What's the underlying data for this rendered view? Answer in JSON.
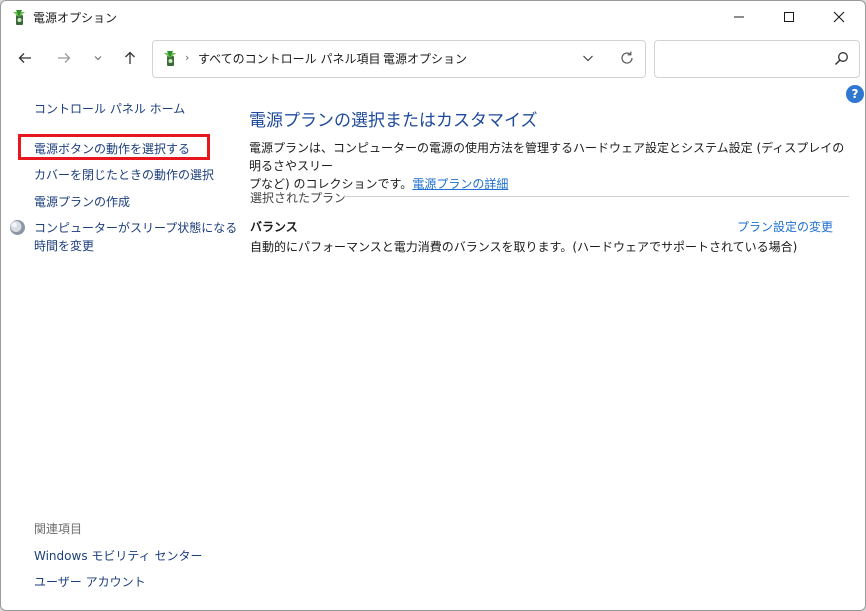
{
  "window": {
    "title": "電源オプション",
    "icon": "power-options-icon"
  },
  "titlebar_buttons": {
    "minimize_icon": "minimize-icon",
    "maximize_icon": "maximize-icon",
    "close_icon": "close-icon"
  },
  "nav": {
    "back_icon": "arrow-left-icon",
    "forward_icon": "arrow-right-icon",
    "recent_icon": "chevron-down-icon",
    "up_icon": "arrow-up-icon"
  },
  "address": {
    "crumb_root": "すべてのコントロール パネル項目",
    "crumb_current": "電源オプション",
    "separator": "›"
  },
  "search": {
    "value": "",
    "icon": "search-icon"
  },
  "sidebar": {
    "home": "コントロール パネル ホーム",
    "items": [
      {
        "label": "電源ボタンの動作を選択する",
        "highlighted": true
      },
      {
        "label": "カバーを閉じたときの動作の選択"
      },
      {
        "label": "電源プランの作成"
      },
      {
        "label": "コンピューターがスリープ状態になる",
        "label2": "時間を変更",
        "icon": "moon-icon"
      }
    ],
    "related_heading": "関連項目",
    "related": [
      {
        "label": "Windows モビリティ センター"
      },
      {
        "label": "ユーザー アカウント"
      }
    ]
  },
  "main": {
    "title": "電源プランの選択またはカスタマイズ",
    "description_1": "電源プランは、コンピューターの電源の使用方法を管理するハードウェア設定とシステム設定 (ディスプレイの明るさやスリー",
    "description_2": "プなど) のコレクションです。",
    "description_link": "電源プランの詳細",
    "section_label": "選択されたプラン",
    "plan": {
      "name": "バランス",
      "description": "自動的にパフォーマンスと電力消費のバランスを取ります。(ハードウェアでサポートされている場合)",
      "change_link": "プラン設定の変更"
    }
  },
  "colors": {
    "link": "#1c3f7c",
    "accent_link": "#1e6fcf",
    "title": "#1e4a9c",
    "highlight": "#e8161f",
    "help": "#2f77d0"
  }
}
